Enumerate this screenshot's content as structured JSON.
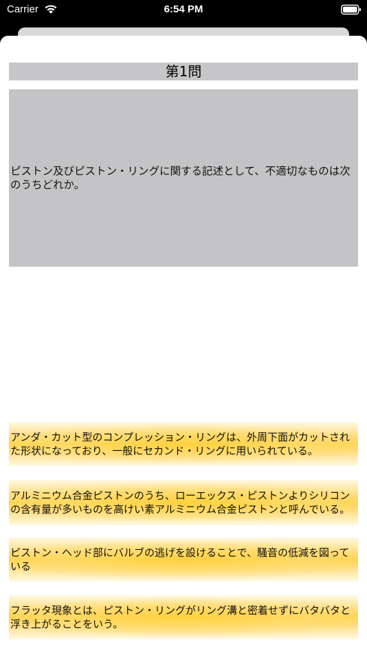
{
  "status_bar": {
    "carrier": "Carrier",
    "time": "6:54 PM"
  },
  "question": {
    "title": "第1問",
    "text": "ピストン及びピストン・リングに関する記述として、不適切なものは次のうちどれか。"
  },
  "options": [
    {
      "text": "アンダ・カット型のコンプレッション・リングは、外周下面がカットされた形状になっており、一般にセカンド・リングに用いられている。"
    },
    {
      "text": "アルミニウム合金ピストンのうち、ローエックス・ピストンよりシリコンの含有量が多いものを高けい素アルミニウム合金ピストンと呼んでいる。"
    },
    {
      "text": "ピストン・ヘッド部にバルブの逃げを設けることで、騒音の低減を図っている"
    },
    {
      "text": "フラッタ現象とは、ピストン・リングがリング溝と密着せずにバタバタと浮き上がることをいう。"
    }
  ],
  "colors": {
    "option_highlight": "#ffd24a",
    "question_bg": "#c4c4c6"
  }
}
